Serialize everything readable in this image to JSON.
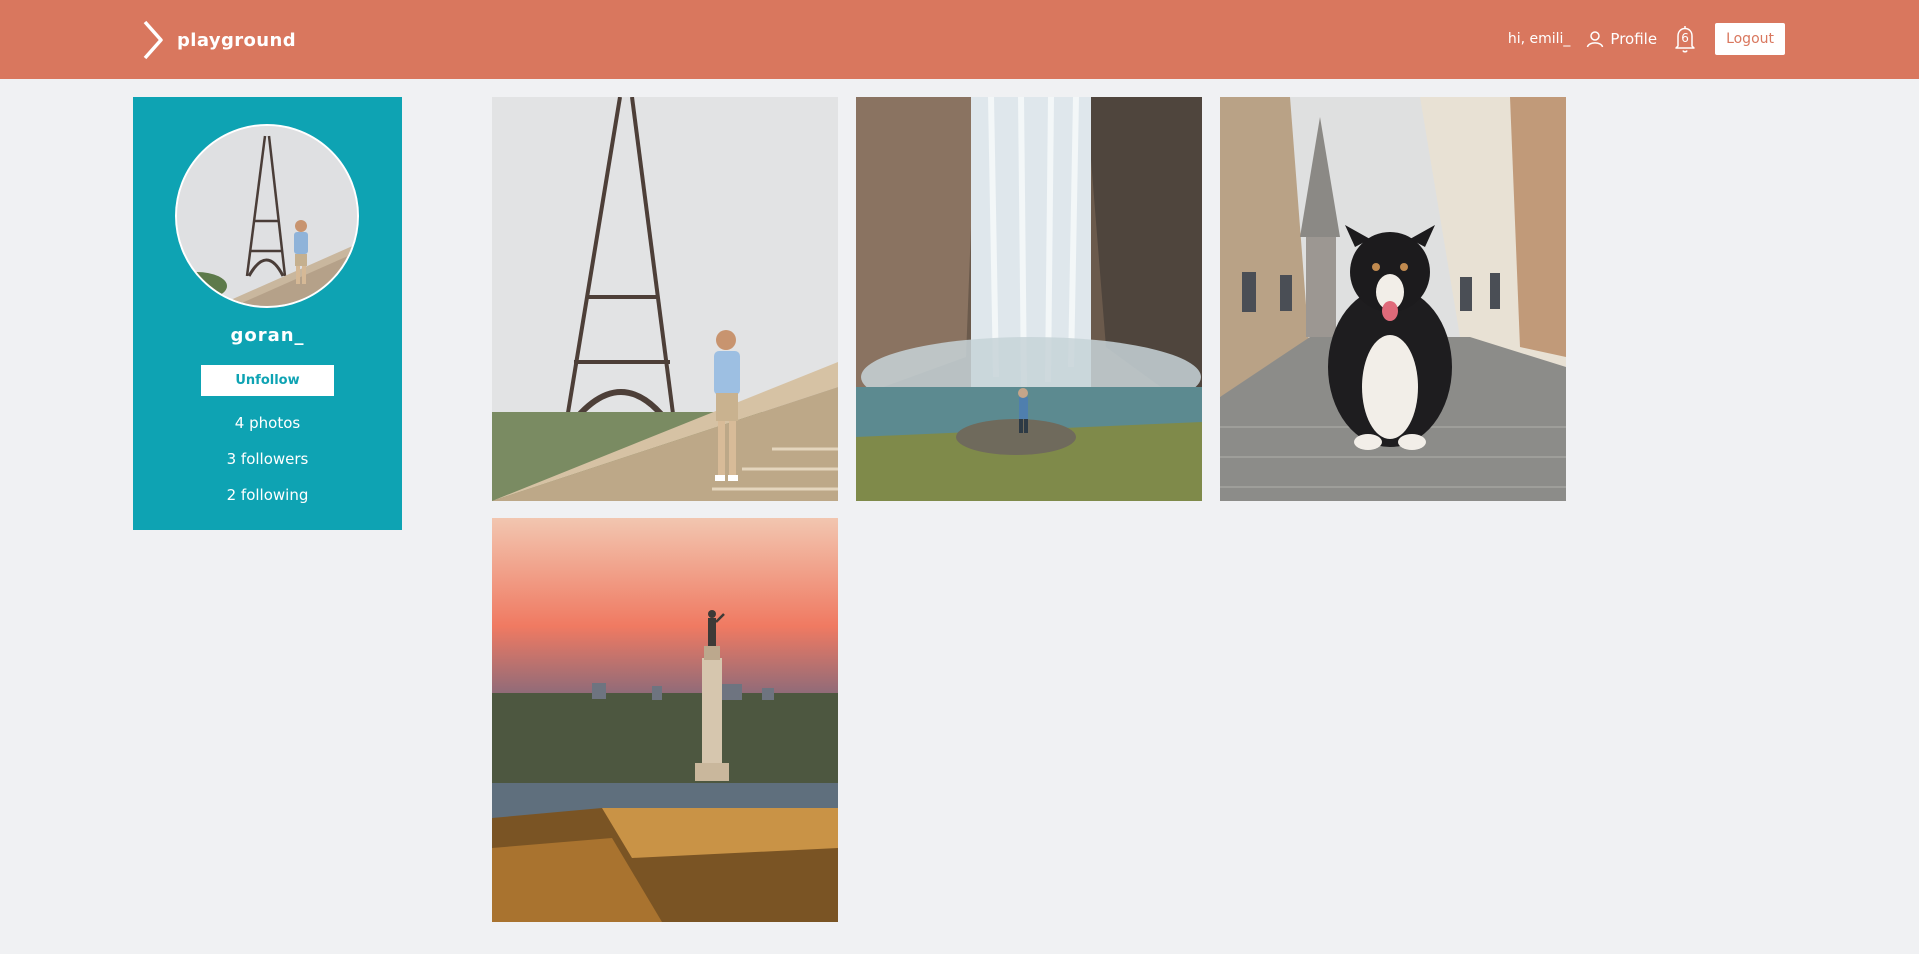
{
  "header": {
    "brand": "playground",
    "greeting": "hi, emili_",
    "profile_label": "Profile",
    "notification_count": "6",
    "logout_label": "Logout",
    "colors": {
      "bar": "#d9775e",
      "text": "#ffffff"
    },
    "icons": [
      "chevron-right-icon",
      "user-icon",
      "bell-icon"
    ]
  },
  "profile": {
    "username": "goran_",
    "follow_button_label": "Unfollow",
    "stats": {
      "photos": "4 photos",
      "followers": "3 followers",
      "following": "2 following"
    },
    "colors": {
      "panel": "#0ea3b3"
    }
  },
  "photos": [
    {
      "subject": "eiffel-tower-with-man"
    },
    {
      "subject": "waterfall-with-person"
    },
    {
      "subject": "dog-on-old-town-street"
    },
    {
      "subject": "monument-at-sunset-over-fortress"
    }
  ]
}
